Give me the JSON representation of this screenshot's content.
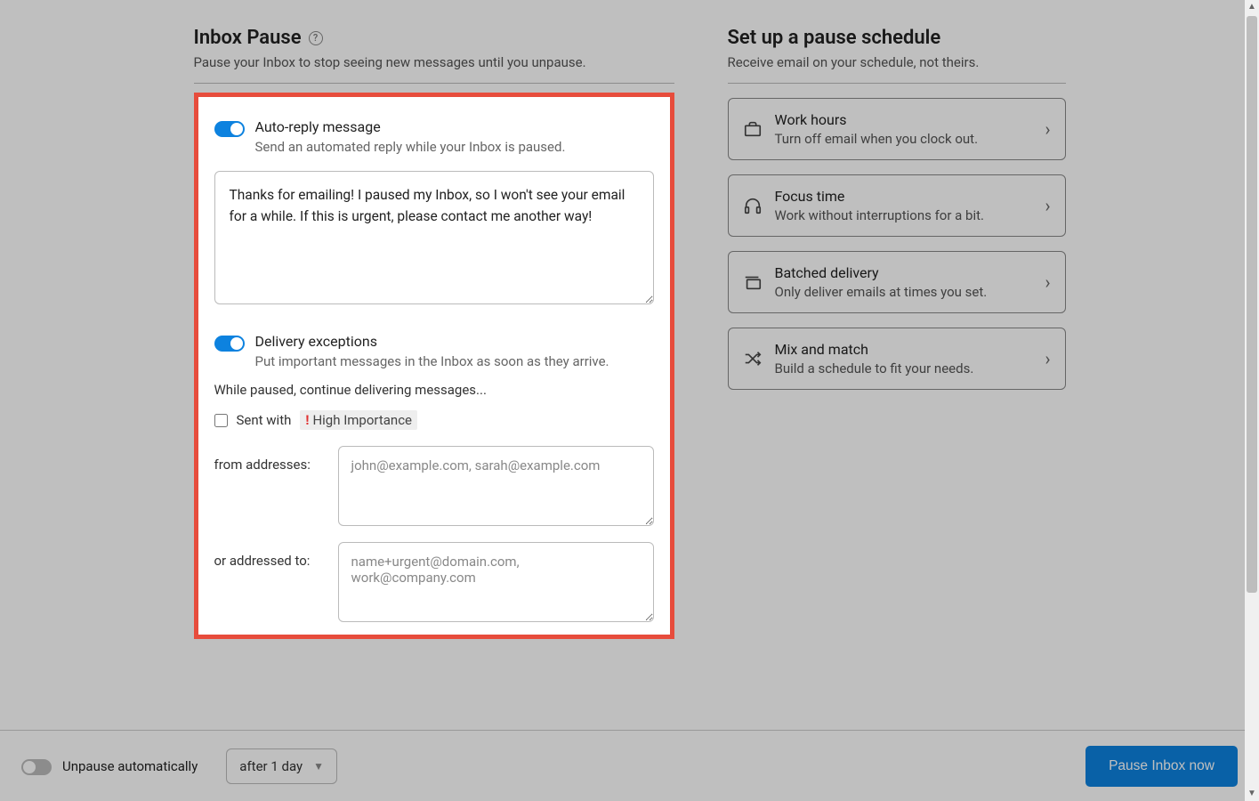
{
  "left": {
    "title": "Inbox Pause",
    "subtitle": "Pause your Inbox to stop seeing new messages until you unpause.",
    "autoReply": {
      "title": "Auto-reply message",
      "desc": "Send an automated reply while your Inbox is paused.",
      "message": "Thanks for emailing! I paused my Inbox, so I won't see your email for a while. If this is urgent, please contact me another way!"
    },
    "exceptions": {
      "title": "Delivery exceptions",
      "desc": "Put important messages in the Inbox as soon as they arrive.",
      "continueLine": "While paused, continue delivering messages...",
      "sentWith": "Sent with",
      "highImportance": "High Importance",
      "fromLabel": "from addresses:",
      "fromPlaceholder": "john@example.com, sarah@example.com",
      "toLabel": "or addressed to:",
      "toPlaceholder": "name+urgent@domain.com, work@company.com"
    }
  },
  "right": {
    "title": "Set up a pause schedule",
    "subtitle": "Receive email on your schedule, not theirs.",
    "cards": [
      {
        "icon": "briefcase-icon",
        "title": "Work hours",
        "desc": "Turn off email when you clock out."
      },
      {
        "icon": "headphones-icon",
        "title": "Focus time",
        "desc": "Work without interruptions for a bit."
      },
      {
        "icon": "stack-icon",
        "title": "Batched delivery",
        "desc": "Only deliver emails at times you set."
      },
      {
        "icon": "shuffle-icon",
        "title": "Mix and match",
        "desc": "Build a schedule to fit your needs."
      }
    ]
  },
  "footer": {
    "unpauseLabel": "Unpause automatically",
    "dropdownValue": "after 1 day",
    "buttonLabel": "Pause Inbox now"
  }
}
